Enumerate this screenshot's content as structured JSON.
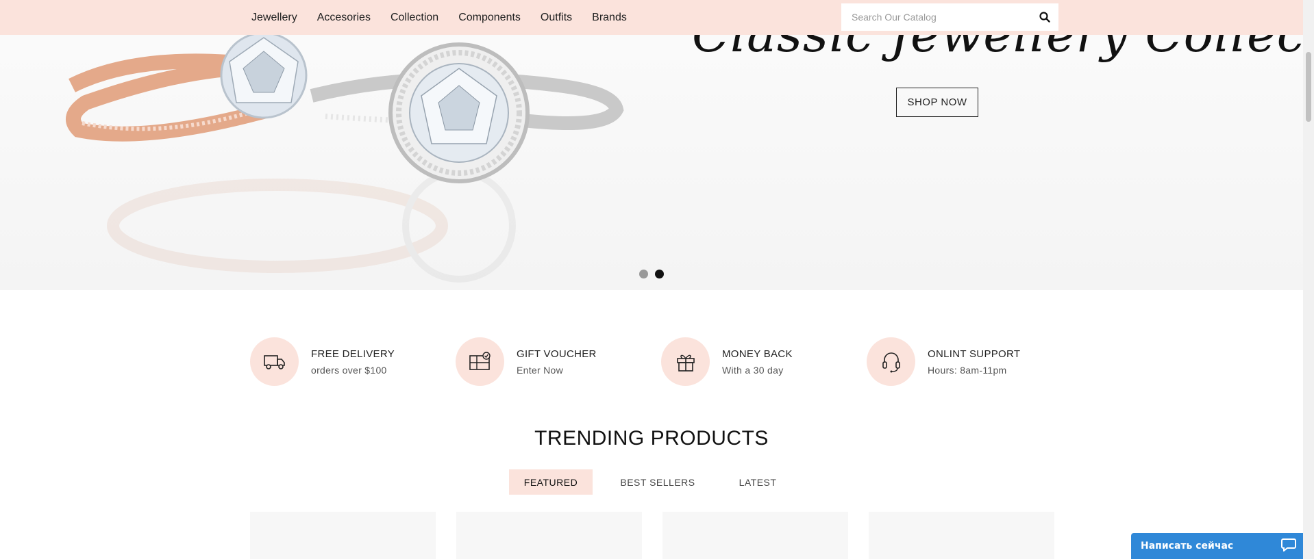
{
  "nav": {
    "items": [
      {
        "label": "Jewellery"
      },
      {
        "label": "Accesories"
      },
      {
        "label": "Collection"
      },
      {
        "label": "Components"
      },
      {
        "label": "Outfits"
      },
      {
        "label": "Brands"
      }
    ],
    "search_placeholder": "Search Our Catalog",
    "search_icon": "search-icon"
  },
  "hero": {
    "title": "Classic Jewellery Collection",
    "button_label": "SHOP NOW",
    "slides_total": 2,
    "active_slide": 2
  },
  "features": [
    {
      "icon": "truck-icon",
      "title": "FREE DELIVERY",
      "subtitle": "orders over $100"
    },
    {
      "icon": "gift-card-icon",
      "title": "GIFT VOUCHER",
      "subtitle": "Enter Now"
    },
    {
      "icon": "gift-box-icon",
      "title": "MONEY BACK",
      "subtitle": "With a 30 day"
    },
    {
      "icon": "headset-icon",
      "title": "ONLINT SUPPORT",
      "subtitle": "Hours: 8am-11pm"
    }
  ],
  "trending": {
    "title": "TRENDING PRODUCTS",
    "tabs": [
      {
        "label": "FEATURED",
        "active": true
      },
      {
        "label": "BEST SELLERS",
        "active": false
      },
      {
        "label": "LATEST",
        "active": false
      }
    ]
  },
  "chat": {
    "label": "Написать сейчас",
    "icon": "chat-bubble-icon",
    "color": "#2f88d8"
  },
  "colors": {
    "accent": "#fbe3dc",
    "text": "#222222"
  }
}
